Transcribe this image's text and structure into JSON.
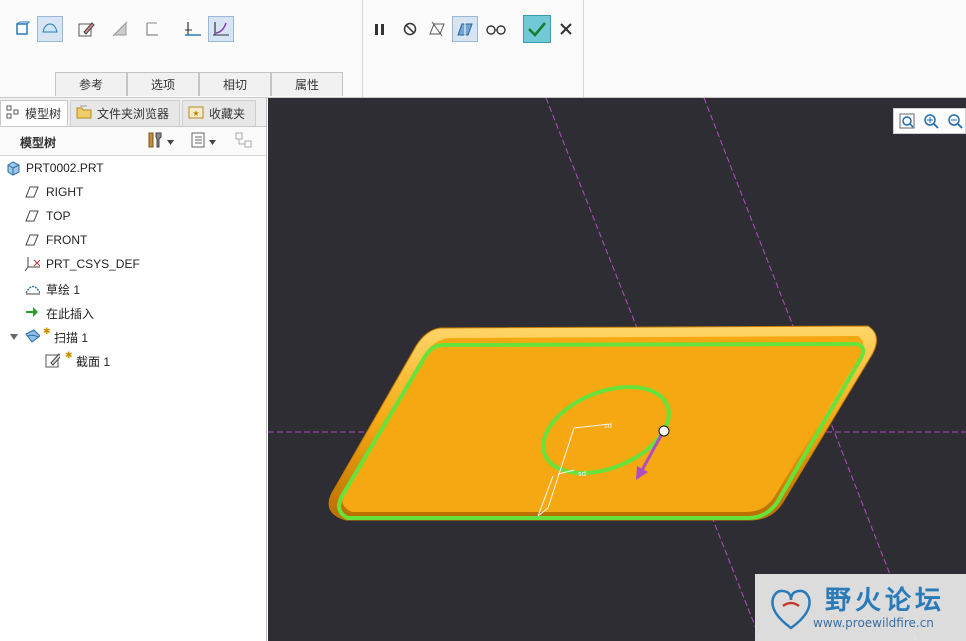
{
  "ribbon": {
    "tabs": [
      {
        "label": "参考"
      },
      {
        "label": "选项"
      },
      {
        "label": "相切"
      },
      {
        "label": "属性"
      }
    ],
    "tools": [
      {
        "icon": "solid-icon"
      },
      {
        "icon": "surface-icon",
        "active": true
      },
      {
        "icon": "sketch-icon"
      },
      {
        "icon": "remove-material-icon"
      },
      {
        "icon": "thin-icon"
      },
      {
        "icon": "constant-section-icon"
      },
      {
        "icon": "variable-section-icon",
        "active": true
      }
    ],
    "controls": [
      {
        "icon": "pause-icon"
      },
      {
        "icon": "no-preview-icon"
      },
      {
        "icon": "geometry-preview-icon"
      },
      {
        "icon": "feature-preview-icon",
        "active": true
      },
      {
        "icon": "verify-icon"
      },
      {
        "icon": "ok-icon"
      },
      {
        "icon": "cancel-icon"
      }
    ]
  },
  "navigator": {
    "tabs": [
      {
        "label": "模型树",
        "icon": "model-tree-icon"
      },
      {
        "label": "文件夹浏览器",
        "icon": "folder-browser-icon"
      },
      {
        "label": "收藏夹",
        "icon": "favorites-icon"
      }
    ],
    "tree_title": "模型树",
    "items": [
      {
        "label": "PRT0002.PRT",
        "icon": "part-icon",
        "level": 0
      },
      {
        "label": "RIGHT",
        "icon": "datum-plane-icon",
        "level": 1
      },
      {
        "label": "TOP",
        "icon": "datum-plane-icon",
        "level": 1
      },
      {
        "label": "FRONT",
        "icon": "datum-plane-icon",
        "level": 1
      },
      {
        "label": "PRT_CSYS_DEF",
        "icon": "csys-icon",
        "level": 1
      },
      {
        "label": "草绘 1",
        "icon": "sketch-feature-icon",
        "level": 1
      },
      {
        "label": "在此插入",
        "icon": "insert-here-icon",
        "level": 1
      },
      {
        "label": "扫描 1",
        "icon": "sweep-icon",
        "level": 1,
        "expanded": true
      },
      {
        "label": "截面 1",
        "icon": "section-icon",
        "level": 2
      }
    ]
  },
  "viewport": {
    "background": "#2e2d33",
    "part_color": "#f5a811",
    "trajectory_color": "#66e23a",
    "datum_color": "#b04ec0",
    "view_tools": [
      {
        "icon": "refit-icon"
      },
      {
        "icon": "zoom-in-icon"
      },
      {
        "icon": "zoom-out-icon"
      }
    ]
  },
  "watermark": {
    "title": "野火论坛",
    "url": "www.proewildfire.cn"
  }
}
